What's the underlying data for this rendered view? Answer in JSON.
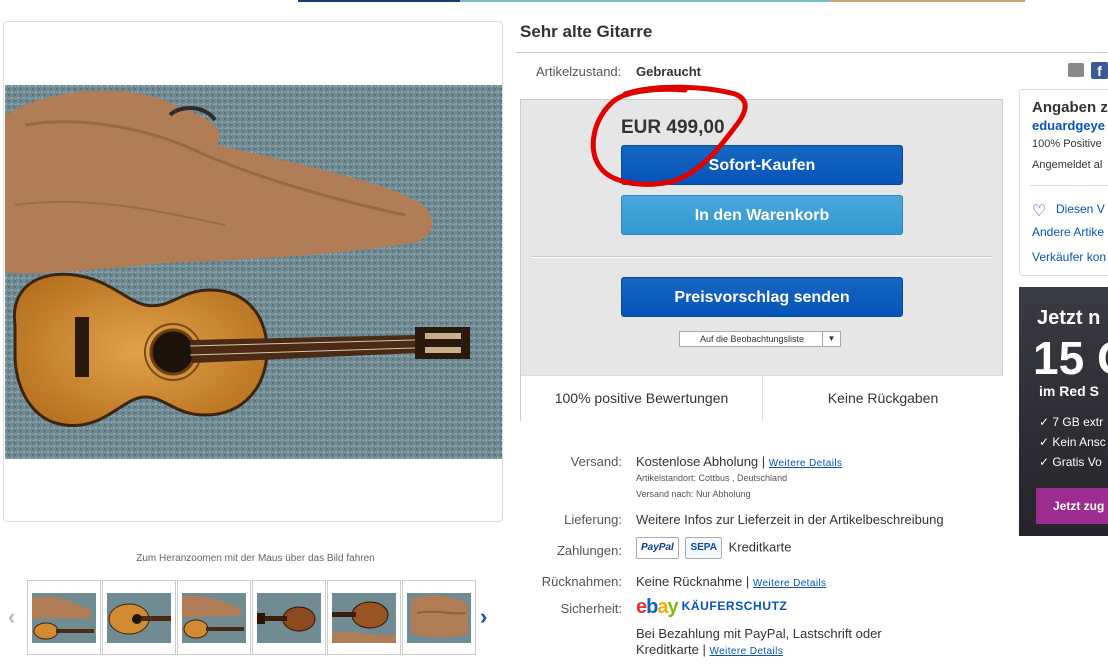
{
  "listing": {
    "title": "Sehr alte Gitarre",
    "condition_label": "Artikelzustand:",
    "condition_value": "Gebraucht"
  },
  "gallery": {
    "zoom_hint": "Zum Heranzoomen mit der Maus über das Bild fahren",
    "thumbnail_count": 6,
    "prev_arrow": "‹",
    "next_arrow": "›"
  },
  "buybox": {
    "price": "EUR 499,00",
    "buy_now_label": "Sofort-Kaufen",
    "cart_label": "In den Warenkorb",
    "offer_label": "Preisvorschlag senden",
    "watchlist_label": "Auf die Beobachtungsliste",
    "feature_left": "100% positive Bewertungen",
    "feature_right": "Keine Rückgaben"
  },
  "details": {
    "shipping_label": "Versand:",
    "shipping_value": "Kostenlose Abholung |",
    "shipping_link": "Weitere Details",
    "location_line": "Artikelstandort:  Cottbus , Deutschland",
    "ships_to_line": "Versand nach:  Nur Abholung",
    "delivery_label": "Lieferung:",
    "delivery_value": "Weitere Infos zur Lieferzeit in der Artikelbeschreibung",
    "payment_label": "Zahlungen:",
    "payment_paypal": "PayPal",
    "payment_sepa": "SEPA",
    "payment_card": "Kreditkarte",
    "returns_label": "Rücknahmen:",
    "returns_value": "Keine Rücknahme |",
    "returns_link": "Weitere Details",
    "security_label": "Sicherheit:",
    "ebay_logo": "ebay",
    "buyer_protection": "KÄUFERSCHUTZ",
    "protection_line1": "Bei Bezahlung mit PayPal, Lastschrift oder",
    "protection_line2": "Kreditkarte |",
    "protection_link": "Weitere Details"
  },
  "seller": {
    "heading": "Angaben z",
    "name": "eduardgeye",
    "positive": "100% Positive",
    "member_since": "Angemeldet al",
    "save_label": "Diesen V",
    "other_items": "Andere Artike",
    "contact": "Verkäufer kon"
  },
  "ad": {
    "line1": "Jetzt n",
    "line2": "15 G",
    "line3": "im Red S",
    "bullets": [
      "7 GB extr",
      "Kein Ansc",
      "Gratis Vo"
    ],
    "cta": "Jetzt zug"
  },
  "colors": {
    "accent_blue": "#0654ba",
    "cart_blue": "#3399d3",
    "annotation_red": "#e00000",
    "ad_purple": "#9c2c8e"
  }
}
